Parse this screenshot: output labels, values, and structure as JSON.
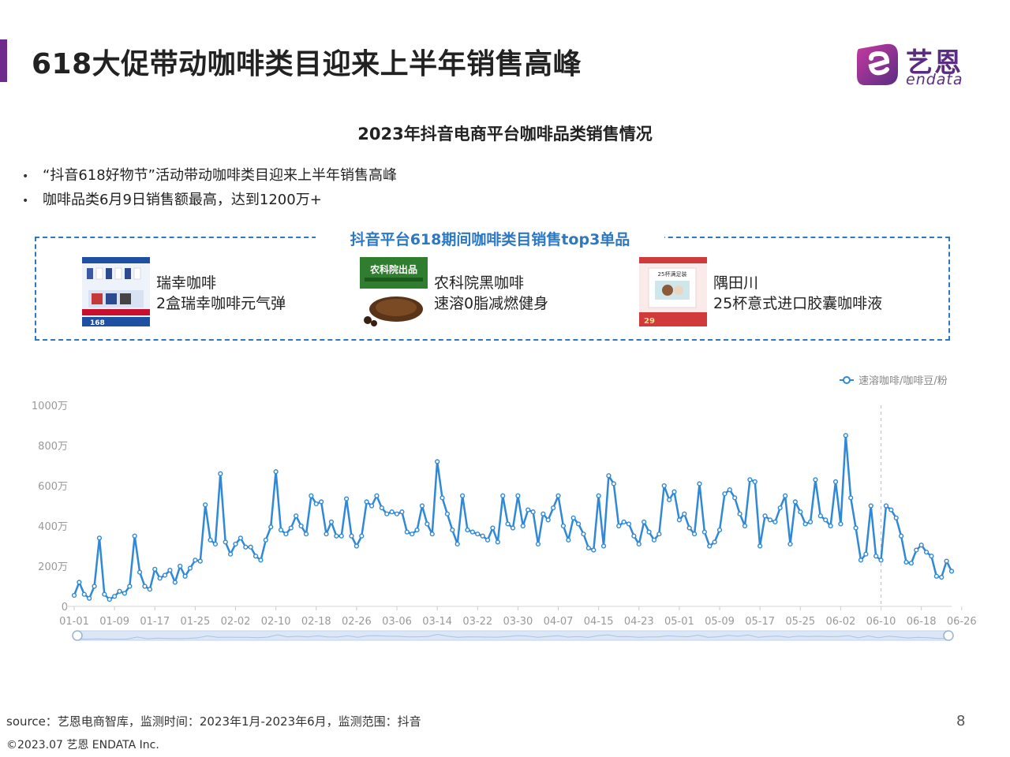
{
  "header": {
    "title": "618大促带动咖啡类目迎来上半年销售高峰",
    "logo_cn": "艺恩",
    "logo_en": "endata"
  },
  "chart_heading": "2023年抖音电商平台咖啡品类销售情况",
  "bullets": [
    "“抖音618好物节”活动带动咖啡类目迎来上半年销售高峰",
    "咖啡品类6月9日销售额最高，达到1200万+"
  ],
  "bullet_marker": "•",
  "top3": {
    "title": "抖音平台618期间咖啡类目销售top3单品",
    "products": [
      {
        "brand": "瑞幸咖啡",
        "name": "2盒瑞幸咖啡元气弹",
        "thumb_price": "168"
      },
      {
        "brand": "农科院黑咖啡",
        "name": "速溶0脂减燃健身",
        "thumb_label": "农科院出品"
      },
      {
        "brand": "隅田川",
        "name": "25杯意式进口胶囊咖啡液",
        "thumb_label": "25杯满足装",
        "thumb_price": "29"
      }
    ]
  },
  "colors": {
    "accent": "#6e2b8c",
    "series": "#2f88d8",
    "box_border": "#2c78c2",
    "logo": "#5a2d82"
  },
  "chart_data": {
    "type": "line",
    "title": "",
    "xlabel": "",
    "ylabel": "",
    "ylim": [
      0,
      1000
    ],
    "y_ticks": [
      0,
      200,
      400,
      600,
      800,
      1000
    ],
    "y_tick_labels": [
      "0",
      "200万",
      "400万",
      "600万",
      "800万",
      "1000万"
    ],
    "x_start": "2023-01-01",
    "x_tick_labels": [
      "01-01",
      "01-09",
      "01-17",
      "01-25",
      "02-02",
      "02-10",
      "02-18",
      "02-26",
      "03-06",
      "03-14",
      "03-22",
      "03-30",
      "04-07",
      "04-15",
      "04-23",
      "05-01",
      "05-09",
      "05-17",
      "05-25",
      "06-02",
      "06-10",
      "06-18",
      "06-26"
    ],
    "highlight_date": "06-10",
    "legend_position": "top-right",
    "grid": false,
    "series": [
      {
        "name": "速溶咖啡/咖啡豆/粉",
        "values": [
          55,
          120,
          60,
          40,
          100,
          340,
          60,
          35,
          50,
          75,
          65,
          100,
          350,
          170,
          100,
          85,
          185,
          140,
          155,
          180,
          120,
          200,
          150,
          190,
          230,
          225,
          505,
          330,
          310,
          660,
          320,
          260,
          310,
          340,
          295,
          295,
          250,
          230,
          330,
          395,
          670,
          380,
          360,
          390,
          450,
          400,
          360,
          550,
          510,
          520,
          360,
          420,
          350,
          350,
          535,
          350,
          300,
          350,
          520,
          500,
          550,
          490,
          460,
          470,
          460,
          470,
          370,
          360,
          380,
          500,
          410,
          360,
          720,
          540,
          460,
          380,
          310,
          550,
          380,
          370,
          360,
          350,
          330,
          390,
          320,
          550,
          410,
          390,
          550,
          400,
          480,
          470,
          310,
          460,
          430,
          490,
          550,
          400,
          330,
          440,
          410,
          360,
          290,
          280,
          550,
          300,
          650,
          610,
          400,
          420,
          410,
          350,
          310,
          420,
          370,
          330,
          360,
          600,
          530,
          570,
          430,
          460,
          390,
          360,
          610,
          370,
          300,
          320,
          380,
          560,
          580,
          540,
          460,
          400,
          630,
          620,
          300,
          450,
          430,
          420,
          490,
          550,
          310,
          520,
          470,
          410,
          420,
          630,
          450,
          430,
          400,
          620,
          410,
          850,
          540,
          390,
          230,
          260,
          500,
          250,
          230,
          500,
          480,
          440,
          350,
          220,
          215,
          280,
          305,
          270,
          250,
          150,
          145,
          225,
          175
        ]
      }
    ]
  },
  "footer": {
    "source": "source：艺恩电商智库，监测时间：2023年1月-2023年6月，监测范围：抖音",
    "copyright": "©2023.07 艺恩 ENDATA Inc.",
    "page": "8"
  }
}
